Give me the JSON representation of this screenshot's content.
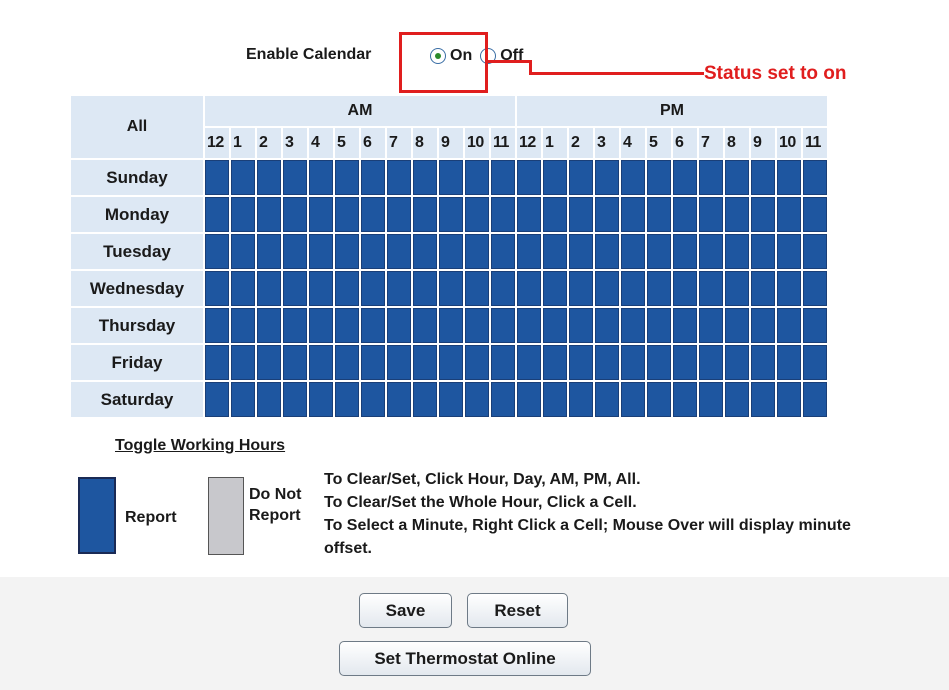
{
  "calendar": {
    "enable_label": "Enable Calendar",
    "options": [
      {
        "label": "On",
        "selected": true
      },
      {
        "label": "Off",
        "selected": false
      }
    ]
  },
  "annotation": {
    "text": "Status set to on",
    "color": "#e01e1e"
  },
  "grid": {
    "all_label": "All",
    "am_label": "AM",
    "pm_label": "PM",
    "am_hours": [
      "12",
      "1",
      "2",
      "3",
      "4",
      "5",
      "6",
      "7",
      "8",
      "9",
      "10",
      "11"
    ],
    "pm_hours": [
      "12",
      "1",
      "2",
      "3",
      "4",
      "5",
      "6",
      "7",
      "8",
      "9",
      "10",
      "11"
    ],
    "days": [
      "Sunday",
      "Monday",
      "Tuesday",
      "Wednesday",
      "Thursday",
      "Friday",
      "Saturday"
    ],
    "report_color": "#1e56a0",
    "no_report_color": "#c8c8cc"
  },
  "legend": {
    "toggle_label": "Toggle Working Hours",
    "report_label": "Report",
    "no_report_label": "Do Not Report"
  },
  "instructions": [
    "To Clear/Set, Click Hour, Day, AM, PM, All.",
    "To Clear/Set the Whole Hour, Click a Cell.",
    "To Select a Minute, Right Click a Cell; Mouse Over will display minute",
    "offset."
  ],
  "buttons": {
    "save": "Save",
    "reset": "Reset",
    "set_online": "Set Thermostat Online"
  }
}
